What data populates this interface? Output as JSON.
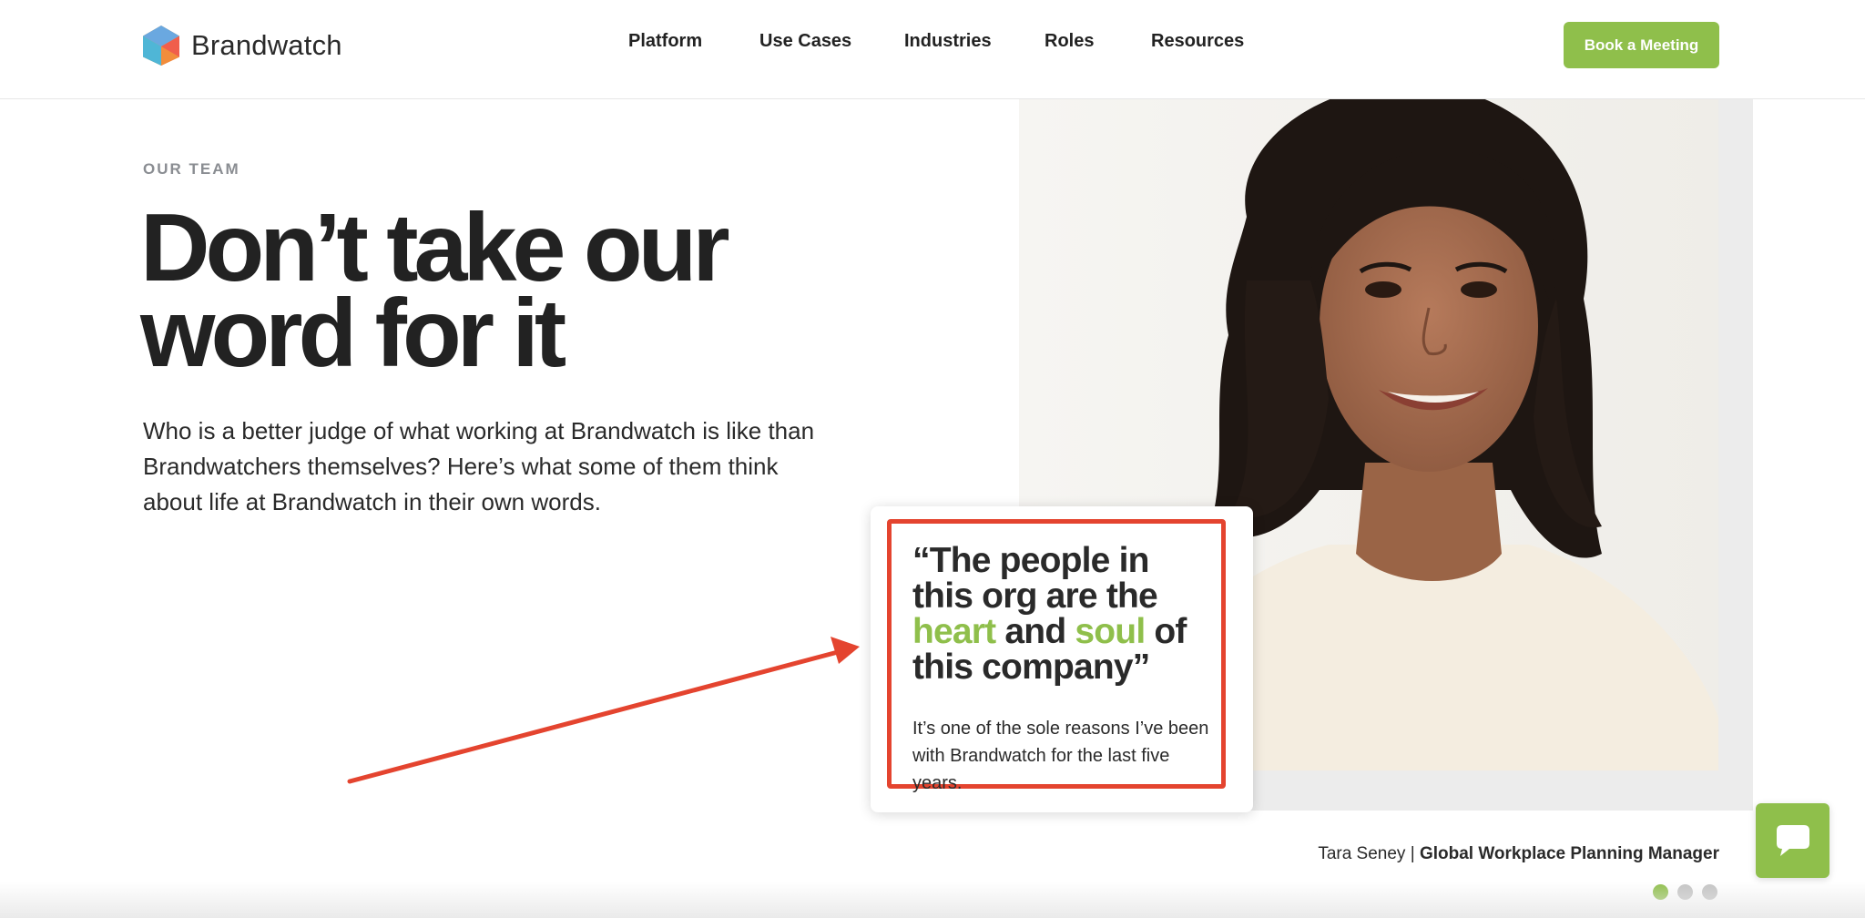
{
  "header": {
    "brand": "Brandwatch",
    "nav": [
      "Platform",
      "Use Cases",
      "Industries",
      "Roles",
      "Resources"
    ],
    "cta_label": "Book a Meeting"
  },
  "hero": {
    "eyebrow": "OUR TEAM",
    "headline_line1": "Don’t take our",
    "headline_line2": "word for it",
    "intro": "Who is a better judge of what working at Brandwatch is like than Brandwatchers themselves? Here’s what some of them think about life at Brandwatch in their own words."
  },
  "testimonial": {
    "quote_part1": "“The people in this org are the ",
    "quote_highlight1": "heart",
    "quote_part2": " and ",
    "quote_highlight2": "soul",
    "quote_part3": " of this company”",
    "body": "It’s one of the sole reasons I’ve been with Brandwatch for the last five years.",
    "name": "Tara Seney",
    "separator": " | ",
    "role": "Global Workplace Planning Manager"
  },
  "carousel": {
    "dot_count": 3,
    "active_index": 1
  },
  "colors": {
    "accent_green": "#8fbf4b",
    "annotation_red": "#e4442f",
    "text_dark": "#222222",
    "eyebrow_gray": "#8a8d92"
  },
  "icons": {
    "logo": "brandwatch-hexagon-logo-icon",
    "chat": "chat-bubble-icon",
    "arrow": "annotation-arrow-icon"
  }
}
